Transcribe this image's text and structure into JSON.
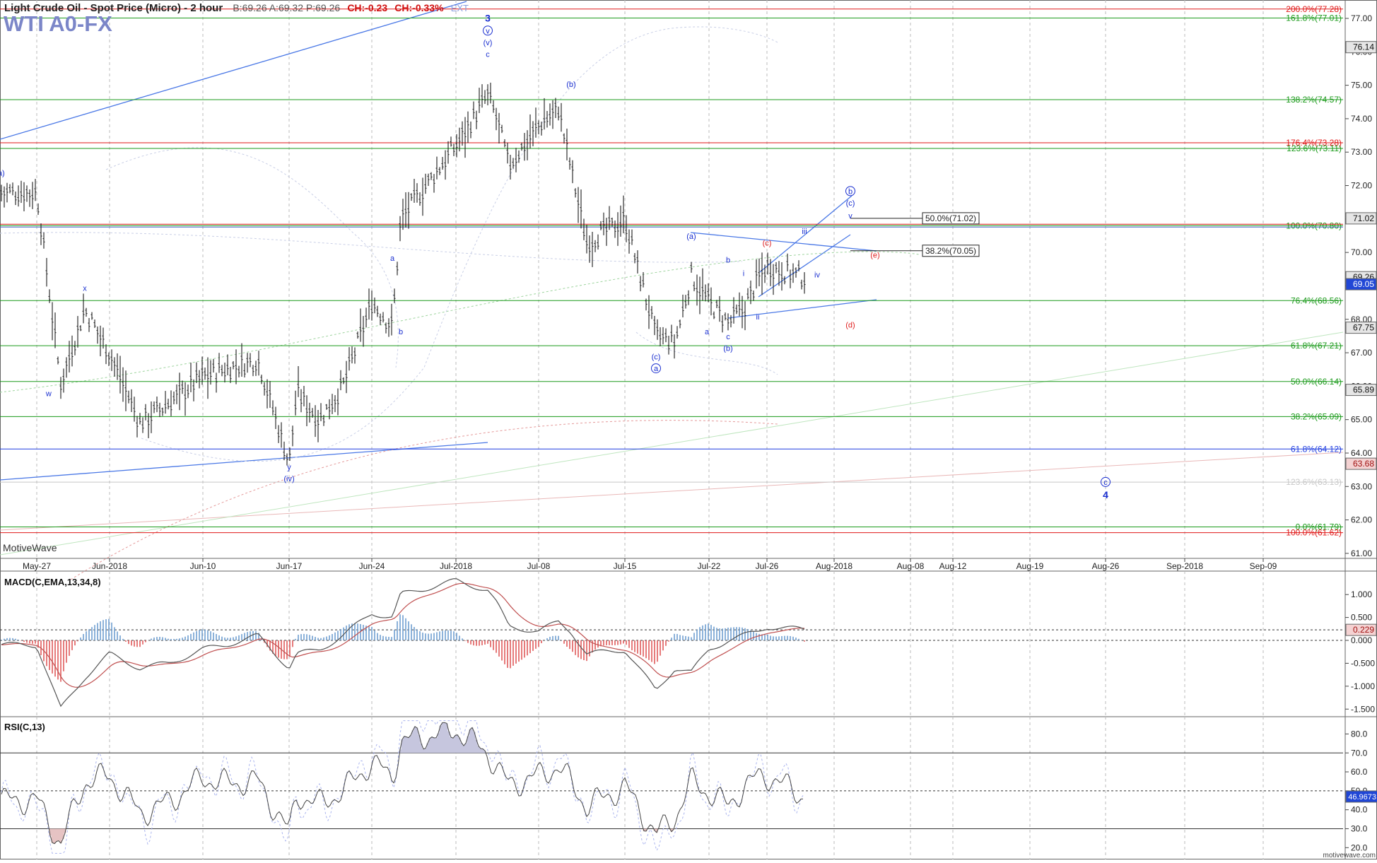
{
  "header": {
    "title": "Light Crude Oil - Spot Price (Micro) - 2 hour",
    "quote": "B:69.26  A:69.32  P:69.26",
    "change_abs": "CH:-0.23",
    "change_pct": "CH:-0.33%",
    "ext": "EXT"
  },
  "symbol": "WTI A0-FX",
  "watermark": "MotiveWave",
  "site": "motivewave.com",
  "colors": {
    "green_level": "#1a9a1a",
    "red_level": "#e01818",
    "blue_level": "#1f3de0",
    "wave_label": "#1a2fd0",
    "alt_label": "#e02020",
    "bar": "#1a1a1a",
    "macd_pos": "#6f9fd0",
    "macd_neg": "#e05a5a"
  },
  "chart_data": [
    {
      "type": "line",
      "title": "Light Crude Oil - Spot Price (Micro) - 2 hour",
      "x_ticks": [
        "May-27",
        "Jun-2018",
        "Jun-10",
        "Jun-17",
        "Jun-24",
        "Jul-2018",
        "Jul-08",
        "Jul-15",
        "Jul-22",
        "Jul-26",
        "Aug-2018",
        "Aug-08",
        "Aug-12",
        "Aug-19",
        "Aug-26",
        "Sep-2018",
        "Sep-09"
      ],
      "y_ticks": [
        "77.00",
        "76.00",
        "75.00",
        "74.00",
        "73.00",
        "72.00",
        "71.00",
        "70.00",
        "69.00",
        "68.00",
        "67.00",
        "66.00",
        "65.00",
        "64.00",
        "63.00",
        "62.00",
        "61.00"
      ],
      "ylim": [
        60.85,
        77.55
      ],
      "x": [
        "May-27",
        "May-29",
        "May-31",
        "Jun-2018",
        "Jun-05",
        "Jun-07",
        "Jun-10",
        "Jun-12",
        "Jun-14",
        "Jun-17",
        "Jun-18",
        "Jun-20",
        "Jun-21",
        "Jun-24",
        "Jun-26",
        "Jun-27",
        "Jul-2018",
        "Jul-03",
        "Jul-04",
        "Jul-06",
        "Jul-08",
        "Jul-10",
        "Jul-11",
        "Jul-12",
        "Jul-15",
        "Jul-17",
        "Jul-18",
        "Jul-19",
        "Jul-22",
        "Jul-23",
        "Jul-24",
        "Jul-25",
        "Jul-26",
        "Jul-27"
      ],
      "series": [
        {
          "values": [
            71.8,
            66.1,
            68.3,
            67.0,
            64.9,
            65.5,
            66.3,
            66.5,
            66.8,
            63.7,
            65.8,
            65.0,
            66.0,
            68.5,
            67.8,
            71.0,
            73.2,
            74.7,
            74.0,
            72.6,
            73.8,
            74.3,
            72.5,
            70.3,
            71.0,
            67.5,
            67.3,
            69.3,
            68.5,
            67.9,
            68.3,
            69.2,
            69.6,
            69.26
          ]
        }
      ],
      "levels": [
        {
          "label": "200.0%(77.28)",
          "value": 77.28,
          "color": "red"
        },
        {
          "label": "161.8%(77.01)",
          "value": 77.01,
          "color": "green"
        },
        {
          "label": "138.2%(74.57)",
          "value": 74.57,
          "color": "green"
        },
        {
          "label": "176.4%(73.28)",
          "value": 73.28,
          "color": "red"
        },
        {
          "label": "123.6%(73.11)",
          "value": 73.11,
          "color": "green"
        },
        {
          "label": "100.0%(70.80)",
          "value": 70.8,
          "color": "green"
        },
        {
          "label": "76.4%(68.56)",
          "value": 68.56,
          "color": "green"
        },
        {
          "label": "61.8%(67.21)",
          "value": 67.21,
          "color": "green"
        },
        {
          "label": "50.0%(66.14)",
          "value": 66.14,
          "color": "green"
        },
        {
          "label": "38.2%(65.09)",
          "value": 65.09,
          "color": "green"
        },
        {
          "label": "61.8%(64.12)",
          "value": 64.12,
          "color": "blue"
        },
        {
          "label": "123.6%(63.13)",
          "value": 63.13,
          "color": "faint"
        },
        {
          "label": "0.0%(61.79)",
          "value": 61.79,
          "color": "green"
        },
        {
          "label": "100.0%(61.62)",
          "value": 61.62,
          "color": "red"
        }
      ],
      "boxed_levels": [
        {
          "label": "50.0%(71.02)",
          "value": 71.02
        },
        {
          "label": "38.2%(70.05)",
          "value": 70.05
        }
      ],
      "price_tags": [
        {
          "text": "76.14",
          "value": 76.14,
          "style": "gray"
        },
        {
          "text": "71.02",
          "value": 71.02,
          "style": "gray"
        },
        {
          "text": "69.26",
          "value": 69.26,
          "style": "gray"
        },
        {
          "text": "69.05",
          "value": 69.05,
          "style": "blue"
        },
        {
          "text": "67.75",
          "value": 67.75,
          "style": "gray"
        },
        {
          "text": "65.89",
          "value": 65.89,
          "style": "gray"
        },
        {
          "text": "63.68",
          "value": 63.68,
          "style": "red"
        }
      ],
      "wave_labels": [
        {
          "text": "3",
          "x": "Jul-03",
          "value": 76.9,
          "color": "blue",
          "bold": true
        },
        {
          "text": "v",
          "x": "Jul-03",
          "value": 76.55,
          "color": "blue",
          "circled": true
        },
        {
          "text": "(v)",
          "x": "Jul-03",
          "value": 76.2,
          "color": "blue"
        },
        {
          "text": "c",
          "x": "Jul-03",
          "value": 75.85,
          "color": "blue"
        },
        {
          "text": "(b)",
          "x": "Jul-11",
          "value": 74.95,
          "color": "blue"
        },
        {
          "text": "(a)",
          "x": "Jul-07",
          "value": 72.3,
          "color": "blue"
        },
        {
          "text": "x",
          "x": "May-31",
          "value": 68.85,
          "color": "blue"
        },
        {
          "text": "w",
          "x": "May-28",
          "value": 65.7,
          "color": "blue"
        },
        {
          "text": "y",
          "x": "Jun-17",
          "value": 63.5,
          "color": "blue"
        },
        {
          "text": "(iv)",
          "x": "Jun-17",
          "value": 63.15,
          "color": "blue"
        },
        {
          "text": "a",
          "x": "Jun-26",
          "value": 69.75,
          "color": "blue"
        },
        {
          "text": "b",
          "x": "Jun-27",
          "value": 67.55,
          "color": "blue"
        },
        {
          "text": "(a)",
          "x": "Jul-19",
          "value": 70.4,
          "color": "blue"
        },
        {
          "text": "b",
          "x": "Jul-23",
          "value": 69.7,
          "color": "blue"
        },
        {
          "text": "a",
          "x": "Jul-21",
          "value": 67.55,
          "color": "blue"
        },
        {
          "text": "c",
          "x": "Jul-23",
          "value": 67.4,
          "color": "blue"
        },
        {
          "text": "(b)",
          "x": "Jul-23",
          "value": 67.05,
          "color": "blue"
        },
        {
          "text": "(c)",
          "x": "Jul-17",
          "value": 66.8,
          "color": "blue"
        },
        {
          "text": "a",
          "x": "Jul-17",
          "value": 66.45,
          "color": "blue",
          "circled": true
        },
        {
          "text": "i",
          "x": "Jul-24",
          "value": 69.3,
          "color": "blue"
        },
        {
          "text": "ii",
          "x": "Jul-25",
          "value": 68.0,
          "color": "blue"
        },
        {
          "text": "iii",
          "x": "Jul-27",
          "value": 70.55,
          "color": "blue"
        },
        {
          "text": "iv",
          "x": "Jul-28",
          "value": 69.25,
          "color": "blue"
        },
        {
          "text": "v",
          "x": "Jul-29",
          "value": 71.02,
          "color": "blue"
        },
        {
          "text": "(c)",
          "x": "Jul-29",
          "value": 71.4,
          "color": "blue"
        },
        {
          "text": "b",
          "x": "Jul-29",
          "value": 71.75,
          "color": "blue",
          "circled": true
        },
        {
          "text": "(c)",
          "x": "Jul-26",
          "value": 70.2,
          "color": "red"
        },
        {
          "text": "(e)",
          "x": "Jul-30",
          "value": 69.85,
          "color": "red"
        },
        {
          "text": "(d)",
          "x": "Jul-29",
          "value": 67.75,
          "color": "red"
        },
        {
          "text": "c",
          "x": "Aug-26",
          "value": 63.05,
          "color": "blue",
          "circled": true
        },
        {
          "text": "4",
          "x": "Aug-26",
          "value": 62.65,
          "color": "blue",
          "bold": true
        }
      ]
    },
    {
      "type": "line",
      "title": "MACD(C,EMA,13,34,8)",
      "y_ticks": [
        "1.000",
        "0.500",
        "0.000",
        "-0.500",
        "-1.000",
        "-1.500"
      ],
      "ylim": [
        -1.65,
        1.45
      ],
      "current_value": "0.229",
      "series": [
        {
          "name": "MACD",
          "values": [
            -0.1,
            -1.5,
            -0.8,
            -0.3,
            -0.6,
            -0.5,
            -0.2,
            -0.1,
            0.1,
            -0.6,
            -0.3,
            -0.2,
            0.1,
            0.6,
            0.5,
            1.0,
            1.3,
            1.1,
            0.8,
            0.3,
            0.2,
            0.4,
            0.2,
            -0.3,
            -0.2,
            -1.1,
            -0.6,
            -0.7,
            -0.2,
            0.0,
            0.1,
            0.2,
            0.3,
            0.23
          ]
        }
      ]
    },
    {
      "type": "line",
      "title": "RSI(C,13)",
      "y_ticks": [
        "80.0",
        "70.0",
        "60.0",
        "50.0",
        "40.0",
        "30.0",
        "20.0"
      ],
      "ylim": [
        16,
        88
      ],
      "current_value": "46.9673",
      "series": [
        {
          "name": "RSI",
          "values": [
            45,
            22,
            55,
            58,
            38,
            44,
            57,
            54,
            55,
            28,
            48,
            43,
            50,
            65,
            57,
            76,
            82,
            70,
            62,
            53,
            58,
            63,
            54,
            42,
            52,
            27,
            36,
            55,
            49,
            42,
            52,
            57,
            58,
            47
          ]
        }
      ]
    }
  ]
}
